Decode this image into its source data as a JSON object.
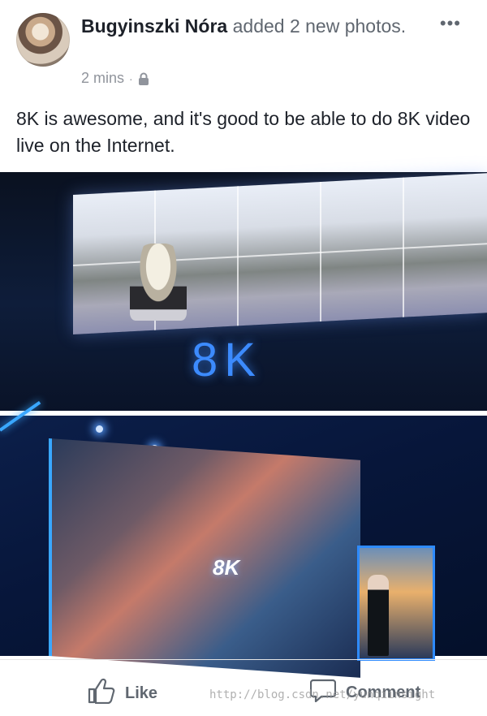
{
  "post": {
    "author": "Bugyinszki Nóra",
    "action": "added 2 new photos.",
    "time": "2 mins",
    "separator": "·",
    "privacy_icon": "lock-icon",
    "more_label": "•••",
    "text": "8K is awesome, and it's good to be able to do 8K video live on the Internet."
  },
  "photos": [
    {
      "overlay_text": "8K"
    },
    {
      "overlay_text": "8K"
    }
  ],
  "actions": {
    "like_label": "Like",
    "comment_label": "Comment"
  },
  "watermark": "http://blog.csdn.net/yunqiinsight",
  "colors": {
    "author": "#1d2129",
    "secondary": "#606770",
    "meta": "#90949c",
    "stage_blue": "#3c8bff"
  }
}
